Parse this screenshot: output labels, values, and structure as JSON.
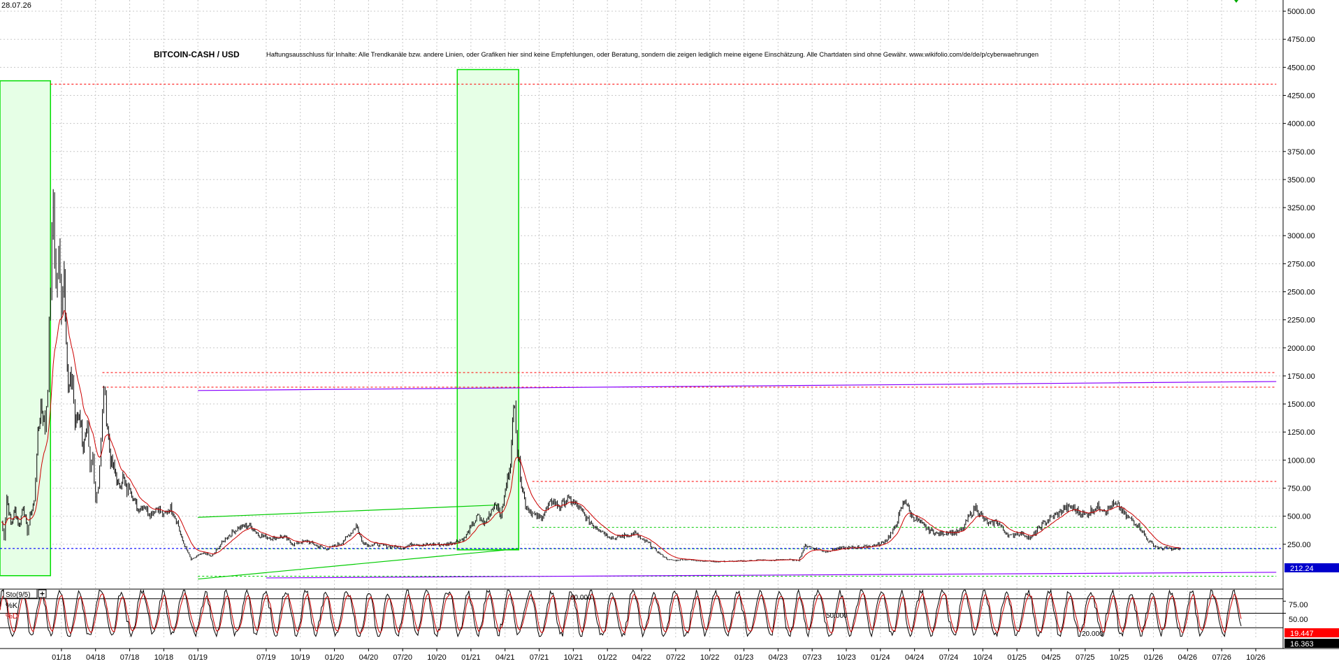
{
  "header": {
    "date": "28.07.26",
    "title": "BITCOIN-CASH / USD",
    "disclaimer": "Haftungsausschluss für Inhalte: Alle Trendkanäle bzw. andere Linien, oder Grafiken hier sind keine Empfehlungen, oder Beratung, sondern die zeigen lediglich meine eigene Einschätzung. Alle Chartdaten sind ohne Gewähr. www.wikifolio.com/de/de/p/cyberwaehrungen"
  },
  "colors": {
    "candle": "#000000",
    "ema": "#cc0000",
    "green_box": "#00dd00",
    "green_fill": "#e6ffe6",
    "resistance": "#ff0000",
    "support": "#00cc00",
    "trend_purple": "#8800ff",
    "current_price_line": "#0000ff",
    "current_price_badge": "#0000cc",
    "k_badge": "#ff0000",
    "d_badge": "#000000"
  },
  "chart_data": [
    {
      "type": "line",
      "series_type": "candlestick",
      "title": "BITCOIN-CASH / USD",
      "x_tick_labels": [
        "01/18",
        "04/18",
        "07/18",
        "10/18",
        "01/19",
        "07/19",
        "10/19",
        "01/20",
        "04/20",
        "07/20",
        "10/20",
        "01/21",
        "04/21",
        "07/21",
        "10/21",
        "01/22",
        "04/22",
        "07/22",
        "10/22",
        "01/23",
        "04/23",
        "07/23",
        "10/23",
        "01/24",
        "04/24",
        "07/24",
        "10/24",
        "01/25",
        "04/25",
        "07/25",
        "10/25",
        "01/26",
        "04/26",
        "07/26",
        "10/26"
      ],
      "x_tick_dates": [
        2018.0,
        2018.25,
        2018.5,
        2018.75,
        2019.0,
        2019.5,
        2019.75,
        2020.0,
        2020.25,
        2020.5,
        2020.75,
        2021.0,
        2021.25,
        2021.5,
        2021.75,
        2022.0,
        2022.25,
        2022.5,
        2022.75,
        2023.0,
        2023.25,
        2023.5,
        2023.75,
        2024.0,
        2024.25,
        2024.5,
        2024.75,
        2025.0,
        2025.25,
        2025.5,
        2025.75,
        2026.0,
        2026.25,
        2026.5,
        2026.75
      ],
      "y_tick_labels": [
        "250.00",
        "500.00",
        "750.00",
        "1000.00",
        "1250.00",
        "1500.00",
        "1750.00",
        "2000.00",
        "2250.00",
        "2500.00",
        "2750.00",
        "3000.00",
        "3250.00",
        "3500.00",
        "3750.00",
        "4000.00",
        "4250.00",
        "4500.00",
        "4750.00",
        "5000.00"
      ],
      "y_ticks": [
        250,
        500,
        750,
        1000,
        1250,
        1500,
        1750,
        2000,
        2250,
        2500,
        2750,
        3000,
        3250,
        3500,
        3750,
        4000,
        4250,
        4500,
        4750,
        5000
      ],
      "ylim": [
        -150,
        5100
      ],
      "xlim": [
        2017.55,
        2026.95
      ],
      "price_points": [
        [
          2017.56,
          450
        ],
        [
          2017.58,
          300
        ],
        [
          2017.6,
          680
        ],
        [
          2017.63,
          420
        ],
        [
          2017.66,
          560
        ],
        [
          2017.69,
          400
        ],
        [
          2017.72,
          600
        ],
        [
          2017.75,
          350
        ],
        [
          2017.77,
          500
        ],
        [
          2017.8,
          620
        ],
        [
          2017.82,
          1100
        ],
        [
          2017.85,
          1500
        ],
        [
          2017.88,
          1300
        ],
        [
          2017.9,
          1700
        ],
        [
          2017.92,
          2600
        ],
        [
          2017.94,
          3300
        ],
        [
          2017.96,
          2500
        ],
        [
          2017.98,
          2800
        ],
        [
          2018.0,
          2400
        ],
        [
          2018.02,
          2700
        ],
        [
          2018.05,
          1600
        ],
        [
          2018.08,
          1750
        ],
        [
          2018.1,
          1300
        ],
        [
          2018.13,
          1450
        ],
        [
          2018.16,
          1100
        ],
        [
          2018.19,
          1250
        ],
        [
          2018.21,
          900
        ],
        [
          2018.23,
          1050
        ],
        [
          2018.25,
          650
        ],
        [
          2018.27,
          780
        ],
        [
          2018.29,
          1150
        ],
        [
          2018.31,
          1650
        ],
        [
          2018.33,
          1400
        ],
        [
          2018.36,
          1000
        ],
        [
          2018.39,
          900
        ],
        [
          2018.42,
          750
        ],
        [
          2018.45,
          850
        ],
        [
          2018.48,
          720
        ],
        [
          2018.5,
          780
        ],
        [
          2018.53,
          650
        ],
        [
          2018.56,
          560
        ],
        [
          2018.6,
          600
        ],
        [
          2018.65,
          520
        ],
        [
          2018.7,
          580
        ],
        [
          2018.75,
          500
        ],
        [
          2018.8,
          580
        ],
        [
          2018.85,
          450
        ],
        [
          2018.88,
          300
        ],
        [
          2018.91,
          220
        ],
        [
          2018.95,
          110
        ],
        [
          2019.0,
          150
        ],
        [
          2019.05,
          170
        ],
        [
          2019.1,
          140
        ],
        [
          2019.2,
          300
        ],
        [
          2019.3,
          400
        ],
        [
          2019.38,
          420
        ],
        [
          2019.45,
          330
        ],
        [
          2019.55,
          300
        ],
        [
          2019.62,
          320
        ],
        [
          2019.7,
          250
        ],
        [
          2019.8,
          280
        ],
        [
          2019.88,
          230
        ],
        [
          2019.95,
          210
        ],
        [
          2020.05,
          260
        ],
        [
          2020.12,
          350
        ],
        [
          2020.16,
          420
        ],
        [
          2020.2,
          280
        ],
        [
          2020.25,
          240
        ],
        [
          2020.3,
          250
        ],
        [
          2020.4,
          230
        ],
        [
          2020.5,
          220
        ],
        [
          2020.58,
          260
        ],
        [
          2020.65,
          240
        ],
        [
          2020.72,
          250
        ],
        [
          2020.8,
          245
        ],
        [
          2020.88,
          270
        ],
        [
          2020.95,
          300
        ],
        [
          2021.0,
          400
        ],
        [
          2021.05,
          500
        ],
        [
          2021.1,
          430
        ],
        [
          2021.15,
          560
        ],
        [
          2021.18,
          620
        ],
        [
          2021.22,
          500
        ],
        [
          2021.26,
          780
        ],
        [
          2021.29,
          1000
        ],
        [
          2021.32,
          1580
        ],
        [
          2021.34,
          1100
        ],
        [
          2021.37,
          800
        ],
        [
          2021.4,
          600
        ],
        [
          2021.45,
          520
        ],
        [
          2021.5,
          480
        ],
        [
          2021.55,
          550
        ],
        [
          2021.6,
          640
        ],
        [
          2021.65,
          580
        ],
        [
          2021.7,
          650
        ],
        [
          2021.75,
          620
        ],
        [
          2021.8,
          560
        ],
        [
          2021.85,
          470
        ],
        [
          2021.9,
          420
        ],
        [
          2021.95,
          380
        ],
        [
          2022.0,
          330
        ],
        [
          2022.05,
          300
        ],
        [
          2022.1,
          320
        ],
        [
          2022.15,
          330
        ],
        [
          2022.2,
          350
        ],
        [
          2022.25,
          290
        ],
        [
          2022.3,
          260
        ],
        [
          2022.35,
          200
        ],
        [
          2022.4,
          150
        ],
        [
          2022.45,
          110
        ],
        [
          2022.5,
          105
        ],
        [
          2022.55,
          115
        ],
        [
          2022.6,
          110
        ],
        [
          2022.7,
          100
        ],
        [
          2022.8,
          95
        ],
        [
          2022.9,
          98
        ],
        [
          2023.0,
          100
        ],
        [
          2023.1,
          110
        ],
        [
          2023.2,
          105
        ],
        [
          2023.3,
          115
        ],
        [
          2023.4,
          105
        ],
        [
          2023.45,
          240
        ],
        [
          2023.5,
          220
        ],
        [
          2023.55,
          200
        ],
        [
          2023.6,
          185
        ],
        [
          2023.7,
          215
        ],
        [
          2023.8,
          220
        ],
        [
          2023.9,
          230
        ],
        [
          2024.0,
          250
        ],
        [
          2024.05,
          300
        ],
        [
          2024.1,
          380
        ],
        [
          2024.15,
          550
        ],
        [
          2024.18,
          650
        ],
        [
          2024.22,
          520
        ],
        [
          2024.28,
          450
        ],
        [
          2024.35,
          380
        ],
        [
          2024.42,
          340
        ],
        [
          2024.5,
          360
        ],
        [
          2024.55,
          350
        ],
        [
          2024.6,
          380
        ],
        [
          2024.65,
          500
        ],
        [
          2024.7,
          580
        ],
        [
          2024.75,
          480
        ],
        [
          2024.8,
          420
        ],
        [
          2024.85,
          460
        ],
        [
          2024.9,
          380
        ],
        [
          2024.95,
          320
        ],
        [
          2025.0,
          350
        ],
        [
          2025.05,
          340
        ],
        [
          2025.1,
          300
        ],
        [
          2025.15,
          380
        ],
        [
          2025.2,
          440
        ],
        [
          2025.25,
          480
        ],
        [
          2025.3,
          520
        ],
        [
          2025.35,
          570
        ],
        [
          2025.4,
          580
        ],
        [
          2025.45,
          540
        ],
        [
          2025.5,
          510
        ],
        [
          2025.55,
          560
        ],
        [
          2025.6,
          590
        ],
        [
          2025.65,
          550
        ],
        [
          2025.7,
          600
        ],
        [
          2025.75,
          580
        ],
        [
          2025.8,
          490
        ],
        [
          2025.85,
          460
        ],
        [
          2025.9,
          400
        ],
        [
          2025.95,
          300
        ],
        [
          2026.0,
          240
        ],
        [
          2026.05,
          210
        ],
        [
          2026.1,
          215
        ],
        [
          2026.15,
          205
        ],
        [
          2026.2,
          212
        ]
      ],
      "annotations": {
        "current_price": "212.24",
        "resistance_levels": [
          4350,
          1780,
          1650,
          810
        ],
        "support_levels": [
          400,
          210,
          -35
        ],
        "purple_trend": [
          [
            2019.0,
            1620
          ],
          [
            2026.9,
            1700
          ]
        ],
        "purple_lower_trend": [
          [
            2019.5,
            -50
          ],
          [
            2026.9,
            0
          ]
        ],
        "green_channel_upper": [
          [
            2019.0,
            490
          ],
          [
            2021.2,
            600
          ]
        ],
        "green_channel_lower": [
          [
            2019.0,
            -60
          ],
          [
            2021.35,
            210
          ]
        ],
        "green_boxes": [
          {
            "x": [
              2017.55,
              2017.92
            ],
            "y": [
              -30,
              4380
            ]
          },
          {
            "x": [
              2020.9,
              2021.35
            ],
            "y": [
              200,
              4480
            ]
          }
        ]
      }
    },
    {
      "type": "line",
      "title": "Sto(9/5)",
      "ylim": [
        0,
        100
      ],
      "y_tick_labels": [
        "75.00",
        "50.00"
      ],
      "y_ticks": [
        75,
        50
      ],
      "level_labels": [
        "80.000",
        "50.000",
        "20.000"
      ],
      "levels": [
        80,
        50,
        20
      ],
      "legend": [
        "%K",
        "%D"
      ],
      "last_values": {
        "k": "19.447",
        "d": "16.363"
      }
    }
  ]
}
